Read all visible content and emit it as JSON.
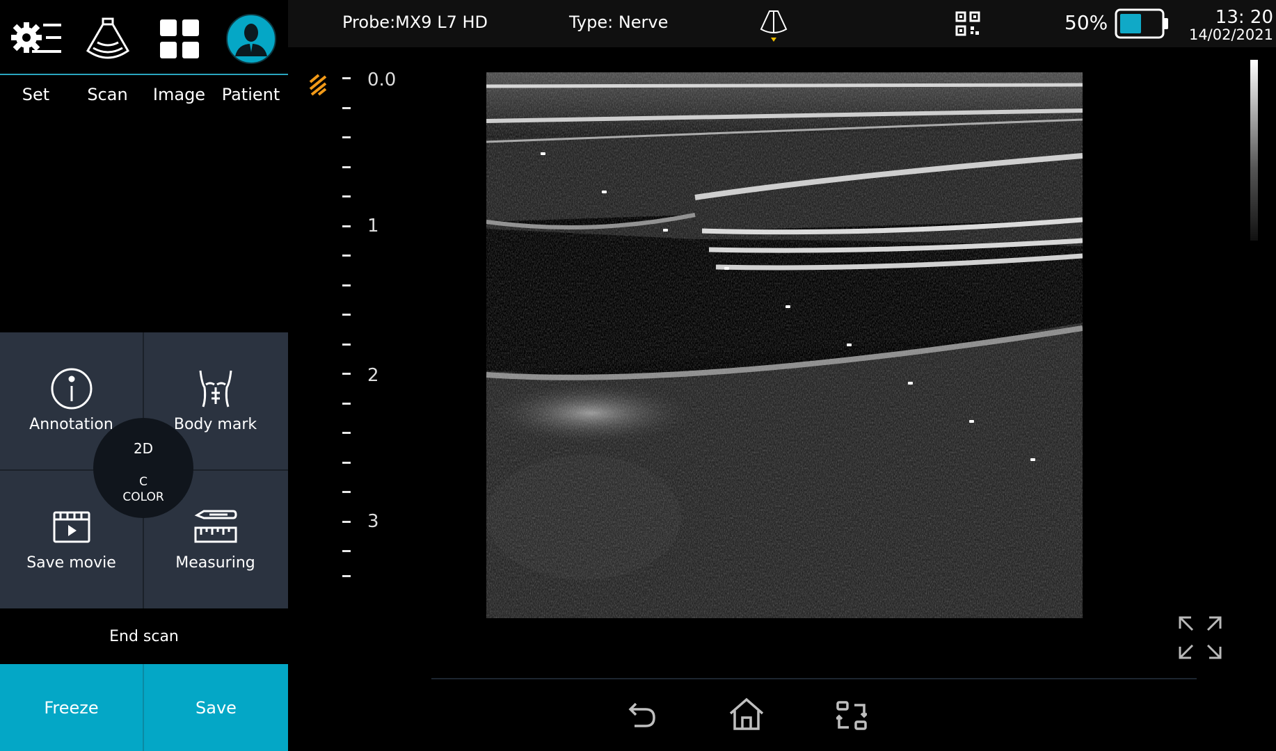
{
  "nav": {
    "set": "Set",
    "scan": "Scan",
    "image": "Image",
    "patient": "Patient"
  },
  "tools": {
    "annotation": "Annotation",
    "body_mark": "Body mark",
    "save_movie": "Save movie",
    "measuring": "Measuring"
  },
  "mode": {
    "mode_2d": "2D",
    "mode_c": "C",
    "mode_color": "COLOR"
  },
  "actions": {
    "end_scan": "End scan",
    "freeze": "Freeze",
    "save": "Save"
  },
  "status": {
    "probe": "Probe:MX9 L7 HD",
    "type": "Type: Nerve",
    "battery": "50%",
    "time": "13: 20",
    "date": "14/02/2021"
  },
  "depth": {
    "labels": [
      "0.0",
      "1",
      "2",
      "3"
    ]
  },
  "colors": {
    "accent": "#04a7c6",
    "panel": "#2b3340",
    "battery_fill": "#10a9c7"
  },
  "icons": {
    "set": "gear-icon",
    "scan": "probe-icon",
    "image": "grid-icon",
    "patient": "person-icon",
    "annotation": "info-icon",
    "body_mark": "torso-icon",
    "save_movie": "film-icon",
    "measuring": "ruler-icon"
  }
}
